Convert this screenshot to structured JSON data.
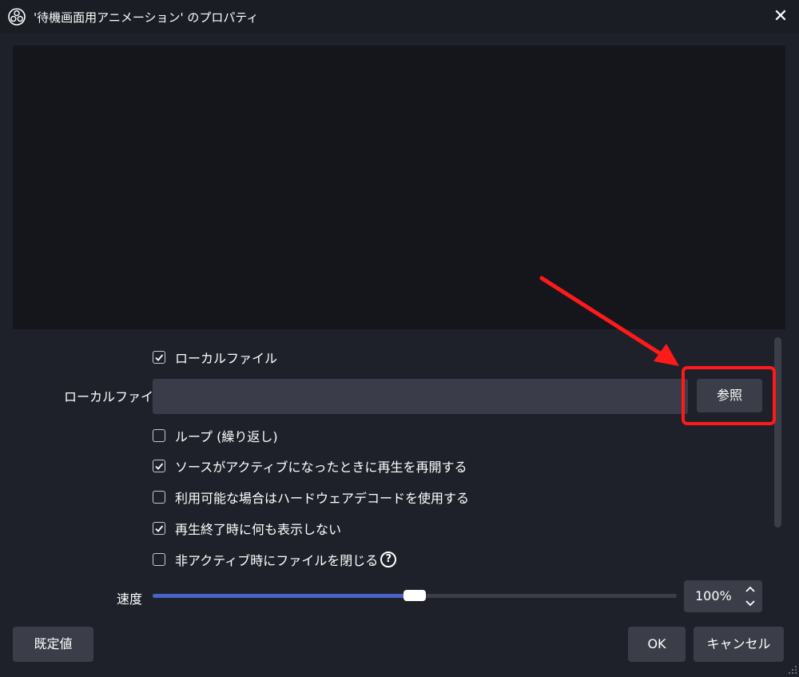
{
  "window": {
    "title": "'待機画面用アニメーション' のプロパティ",
    "app_icon": "obs-icon",
    "close_label": "✕"
  },
  "properties": {
    "local_file_checkbox": {
      "label": "ローカルファイル",
      "checked": true
    },
    "local_file_field": {
      "label": "ローカルファイル",
      "value": ""
    },
    "browse_button_label": "参照",
    "loop_checkbox": {
      "label": "ループ (繰り返し)",
      "checked": false
    },
    "restart_checkbox": {
      "label": "ソースがアクティブになったときに再生を再開する",
      "checked": true
    },
    "hw_decode_checkbox": {
      "label": "利用可能な場合はハードウェアデコードを使用する",
      "checked": false
    },
    "hide_on_end_checkbox": {
      "label": "再生終了時に何も表示しない",
      "checked": true
    },
    "close_inactive_checkbox": {
      "label": "非アクティブ時にファイルを閉じる",
      "checked": false,
      "help_icon": "question-circle-icon",
      "help_glyph": "?"
    },
    "speed": {
      "label": "速度",
      "value_text": "100%",
      "slider_fraction": 0.5
    }
  },
  "footer": {
    "defaults_button_label": "既定値",
    "ok_button_label": "OK",
    "cancel_button_label": "キャンセル"
  },
  "colors": {
    "accent": "#4b63c6",
    "annotation_red": "#ff1a1a"
  }
}
